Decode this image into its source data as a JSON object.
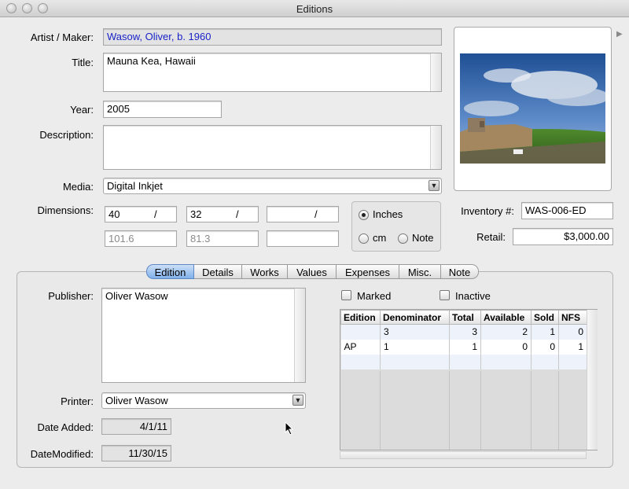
{
  "window": {
    "title": "Editions"
  },
  "form": {
    "artist_label": "Artist / Maker:",
    "artist_value": "Wasow, Oliver, b. 1960",
    "title_label": "Title:",
    "title_value": "Mauna Kea, Hawaii",
    "year_label": "Year:",
    "year_value": "2005",
    "description_label": "Description:",
    "description_value": "",
    "media_label": "Media:",
    "media_value": "Digital Inkjet",
    "dimensions_label": "Dimensions:",
    "dim_inches": [
      "40",
      "32",
      ""
    ],
    "dim_cm": [
      "101.6",
      "81.3",
      ""
    ],
    "dim_sep": "/",
    "units": {
      "inches": "Inches",
      "cm": "cm",
      "note": "Note",
      "selected": "Inches"
    },
    "inventory_label": "Inventory #:",
    "inventory_value": "WAS-006-ED",
    "retail_label": "Retail:",
    "retail_value": "$3,000.00"
  },
  "tabs": [
    "Edition",
    "Details",
    "Works",
    "Values",
    "Expenses",
    "Misc.",
    "Note"
  ],
  "active_tab": "Edition",
  "edition": {
    "publisher_label": "Publisher:",
    "publisher_value": "Oliver Wasow",
    "printer_label": "Printer:",
    "printer_value": "Oliver Wasow",
    "date_added_label": "Date Added:",
    "date_added_value": "4/1/11",
    "date_modified_label": "DateModified:",
    "date_modified_value": "11/30/15",
    "marked_label": "Marked",
    "inactive_label": "Inactive"
  },
  "table": {
    "headers": [
      "Edition",
      "Denominator",
      "Total",
      "Available",
      "Sold",
      "NFS"
    ],
    "rows": [
      [
        "",
        "3",
        "3",
        "2",
        "1",
        "0"
      ],
      [
        "AP",
        "1",
        "1",
        "0",
        "0",
        "1"
      ]
    ]
  },
  "colors": {
    "artist_text": "#1a23c8",
    "tab_active": "#7fb0ea"
  },
  "icons": [
    "popup-arrow-icon",
    "image-well-arrow-icon",
    "mouse-cursor-icon"
  ]
}
